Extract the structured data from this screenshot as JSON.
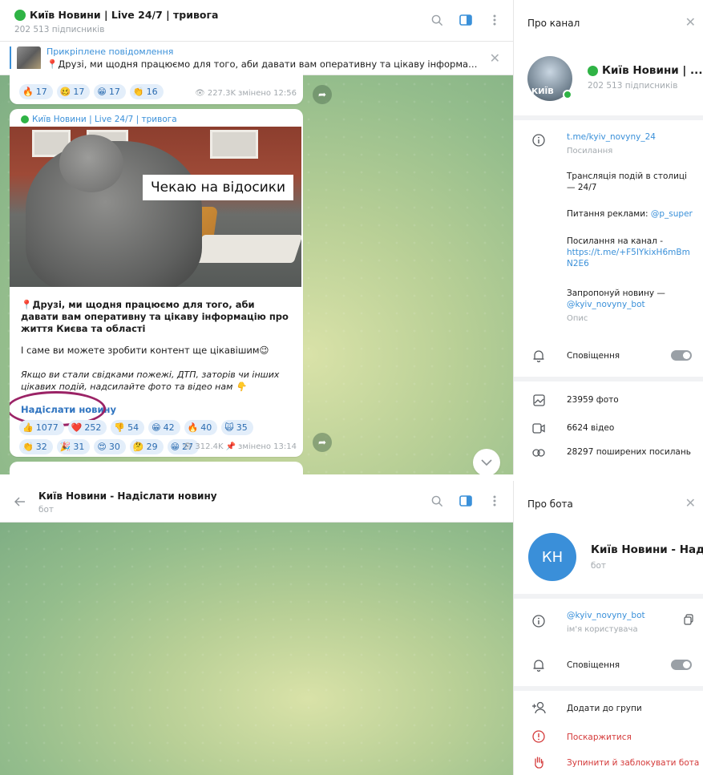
{
  "channel_chat": {
    "title": "Київ Новини | Live 24/7 | тривога",
    "subscribers": "202 513 підписників",
    "pinned": {
      "label": "Прикріплене повідомлення",
      "text": "📍Друзі, ми щодня працюємо для того, аби давати вам оперативну та цікаву інформацію пр..."
    },
    "prev_post": {
      "reactions": [
        {
          "emoji": "🔥",
          "count": "17"
        },
        {
          "emoji": "🥴",
          "count": "17"
        },
        {
          "emoji": "😁",
          "count": "17"
        },
        {
          "emoji": "👏",
          "count": "16"
        }
      ],
      "views": "227.3K",
      "edited": "змінено 12:56"
    },
    "post": {
      "channel": "Київ Новини | Live 24/7 | тривога",
      "image_caption": "Чекаю на відосики",
      "text_bold": "📍Друзі, ми щодня працюємо для того, аби давати вам оперативну та цікаву інформацію про життя Києва та області",
      "text_plain": "І саме ви можете зробити контент ще цікавішим😉",
      "text_italic": "Якщо ви стали свідками пожежі, ДТП, заторів чи інших цікавих подій, надсилайте фото та відео нам 👇",
      "link": "Надіслати новину",
      "reactions": [
        {
          "emoji": "👍",
          "count": "1077"
        },
        {
          "emoji": "❤️",
          "count": "252"
        },
        {
          "emoji": "👎",
          "count": "54"
        },
        {
          "emoji": "😁",
          "count": "42"
        },
        {
          "emoji": "🔥",
          "count": "40"
        },
        {
          "emoji": "🙀",
          "count": "35"
        },
        {
          "emoji": "👏",
          "count": "32"
        },
        {
          "emoji": "🎉",
          "count": "31"
        },
        {
          "emoji": "😍",
          "count": "30"
        },
        {
          "emoji": "🤔",
          "count": "29"
        },
        {
          "emoji": "😁",
          "count": "27"
        }
      ],
      "views": "312.4K",
      "edited": "змінено 13:14"
    }
  },
  "channel_info": {
    "title": "Про канал",
    "name": "Київ Новини | ...",
    "subscribers": "202 513 підписників",
    "avatar_text": "КИЇВ",
    "link": "t.me/kyiv_novyny_24",
    "link_label": "Посилання",
    "desc1": "Трансляція подій в столиці — 24/7",
    "ads_prefix": "Питання реклами: ",
    "ads_handle": "@p_super",
    "channel_link_prefix": "Посилання на канал -",
    "channel_link": "https://t.me/+F5IYkixH6mBmN2E6",
    "suggest_prefix": "Запропонуй новину —",
    "suggest_bot": "@kyiv_novyny_bot",
    "desc_label": "Опис",
    "notifications": "Сповіщення",
    "photos": "23959 фото",
    "videos": "6624 відео",
    "links": "28297 поширених посилань"
  },
  "bot_chat": {
    "title": "Київ Новини - Надіслати новину",
    "sub": "бот"
  },
  "bot_info": {
    "title": "Про бота",
    "initials": "КН",
    "name": "Київ Новини - Над...",
    "sub": "бот",
    "username": "@kyiv_novyny_bot",
    "username_label": "ім'я користувача",
    "notifications": "Сповіщення",
    "add_group": "Додати до групи",
    "report": "Поскаржитися",
    "block": "Зупинити й заблокувати бота"
  },
  "colors": {
    "accent": "#3a90d9",
    "danger": "#d43a3a",
    "online": "#2fb345",
    "annotation": "#9b2366"
  }
}
